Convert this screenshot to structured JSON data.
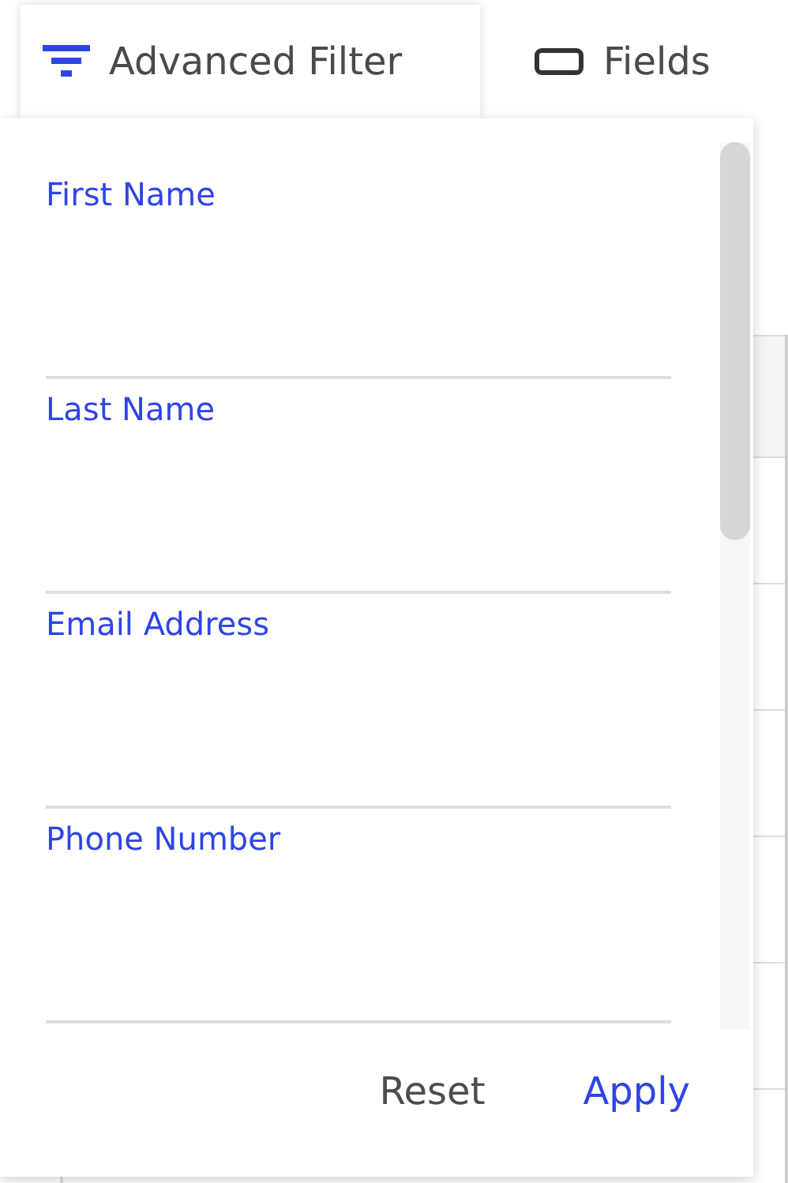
{
  "toolbar": [
    {
      "kind": "filter",
      "label": "Advanced Filter",
      "selected": true
    },
    {
      "kind": "fields",
      "label": "Fields",
      "selected": false
    }
  ],
  "filter_panel": {
    "fields": [
      {
        "label": "First Name"
      },
      {
        "label": "Last Name"
      },
      {
        "label": "Email Address"
      },
      {
        "label": "Phone Number"
      }
    ],
    "buttons": [
      {
        "kind": "secondary",
        "label": "Reset"
      },
      {
        "kind": "primary",
        "label": "Apply"
      }
    ]
  }
}
